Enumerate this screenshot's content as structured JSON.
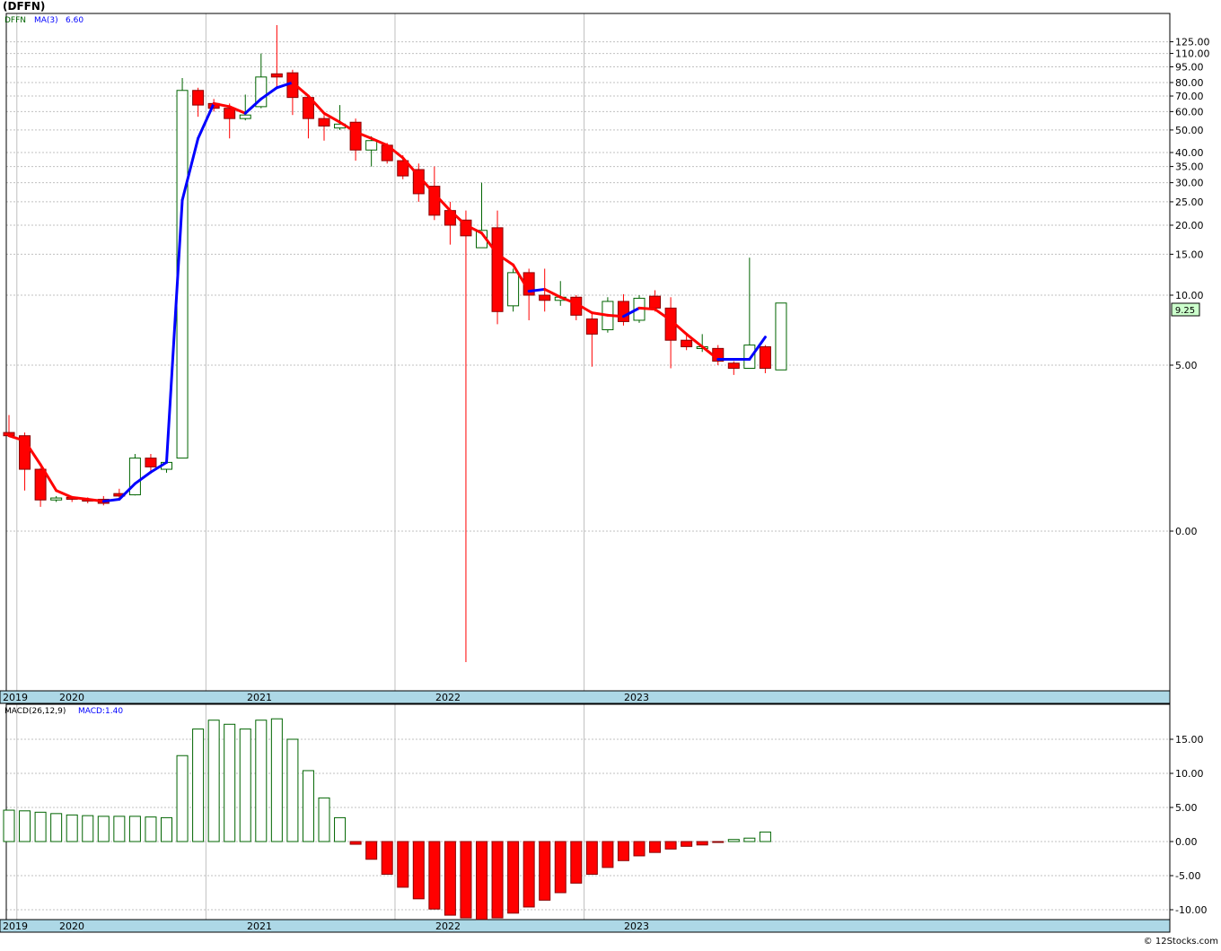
{
  "header": {
    "symbol": "(DFFN)"
  },
  "upper_legend": {
    "symbol": "DFFN",
    "ma_label": "MA(3)",
    "ma_value": "6.60"
  },
  "lower_legend": {
    "label": "MACD(26,12,9)",
    "value_label": "MACD:1.40"
  },
  "last_price_label": "9.25",
  "footer": {
    "copyright": "© 12Stocks.com"
  },
  "colors": {
    "up": "#006400",
    "down": "#ff0000",
    "ma_up": "#0000ff",
    "ma_down": "#ff0000",
    "grid": "#c0c0c0",
    "axis_band": "#add8e6",
    "last_price_bg": "#ccffcc"
  },
  "chart_data": [
    {
      "type": "candlestick",
      "title": "(DFFN)",
      "scale": "log",
      "interval": "monthly",
      "x_axis_labels": [
        "2019",
        "2020",
        "2021",
        "2022",
        "2023"
      ],
      "y_tick_labels": [
        "125.00",
        "110.00",
        "95.00",
        "80.00",
        "70.00",
        "60.00",
        "50.00",
        "40.00",
        "35.00",
        "30.00",
        "25.00",
        "20.00",
        "15.00",
        "10.00",
        "5.00",
        "0.00"
      ],
      "last_close": 9.25,
      "ma_period": 3,
      "ma_last": 6.6,
      "candles": [
        {
          "date": "2019-12",
          "open": 1.9,
          "high": 2.5,
          "low": 1.85,
          "close": 1.8
        },
        {
          "date": "2020-01",
          "open": 1.8,
          "high": 1.9,
          "low": 0.55,
          "close": 0.95
        },
        {
          "date": "2020-02",
          "open": 0.95,
          "high": 0.98,
          "low": 0.3,
          "close": 0.4
        },
        {
          "date": "2020-03",
          "open": 0.4,
          "high": 0.46,
          "low": 0.37,
          "close": 0.43
        },
        {
          "date": "2020-04",
          "open": 0.44,
          "high": 0.45,
          "low": 0.37,
          "close": 0.41
        },
        {
          "date": "2020-05",
          "open": 0.41,
          "high": 0.44,
          "low": 0.35,
          "close": 0.4
        },
        {
          "date": "2020-06",
          "open": 0.41,
          "high": 0.46,
          "low": 0.32,
          "close": 0.35
        },
        {
          "date": "2020-07",
          "open": 0.5,
          "high": 0.58,
          "low": 0.4,
          "close": 0.46
        },
        {
          "date": "2020-08",
          "open": 0.48,
          "high": 1.3,
          "low": 0.47,
          "close": 1.2
        },
        {
          "date": "2020-09",
          "open": 1.2,
          "high": 1.3,
          "low": 0.9,
          "close": 1.0
        },
        {
          "date": "2020-10",
          "open": 0.95,
          "high": 1.45,
          "low": 0.88,
          "close": 1.1
        },
        {
          "date": "2020-11",
          "open": 1.2,
          "high": 84,
          "low": 1.2,
          "close": 74
        },
        {
          "date": "2020-12",
          "open": 74,
          "high": 76,
          "low": 57,
          "close": 64
        },
        {
          "date": "2021-01",
          "open": 65,
          "high": 68,
          "low": 60,
          "close": 62
        },
        {
          "date": "2021-02",
          "open": 62,
          "high": 65,
          "low": 46,
          "close": 56
        },
        {
          "date": "2021-03",
          "open": 56,
          "high": 71,
          "low": 55,
          "close": 58
        },
        {
          "date": "2021-04",
          "open": 63,
          "high": 110,
          "low": 62,
          "close": 85
        },
        {
          "date": "2021-05",
          "open": 88,
          "high": 150,
          "low": 75,
          "close": 85
        },
        {
          "date": "2021-06",
          "open": 89,
          "high": 92,
          "low": 58,
          "close": 69
        },
        {
          "date": "2021-07",
          "open": 69,
          "high": 71,
          "low": 46,
          "close": 56
        },
        {
          "date": "2021-08",
          "open": 56,
          "high": 58,
          "low": 45,
          "close": 52
        },
        {
          "date": "2021-09",
          "open": 51,
          "high": 64,
          "low": 50,
          "close": 53
        },
        {
          "date": "2021-10",
          "open": 54,
          "high": 56,
          "low": 37,
          "close": 41
        },
        {
          "date": "2021-11",
          "open": 41,
          "high": 47,
          "low": 35,
          "close": 45
        },
        {
          "date": "2021-12",
          "open": 43,
          "high": 44,
          "low": 36,
          "close": 37
        },
        {
          "date": "2022-01",
          "open": 37,
          "high": 39,
          "low": 31,
          "close": 32
        },
        {
          "date": "2022-02",
          "open": 34,
          "high": 36,
          "low": 25,
          "close": 27
        },
        {
          "date": "2022-03",
          "open": 29,
          "high": 35,
          "low": 21,
          "close": 22
        },
        {
          "date": "2022-04",
          "open": 23,
          "high": 25,
          "low": 16.5,
          "close": 20
        },
        {
          "date": "2022-05",
          "open": 21,
          "high": 23,
          "low": -2.4,
          "close": 18
        },
        {
          "date": "2022-06",
          "open": 16,
          "high": 30,
          "low": 16,
          "close": 19
        },
        {
          "date": "2022-07",
          "open": 19.5,
          "high": 23,
          "low": 7.5,
          "close": 8.5
        },
        {
          "date": "2022-08",
          "open": 9,
          "high": 13,
          "low": 8.5,
          "close": 12.5
        },
        {
          "date": "2022-09",
          "open": 12.5,
          "high": 13,
          "low": 7.8,
          "close": 10
        },
        {
          "date": "2022-10",
          "open": 10,
          "high": 13,
          "low": 8.5,
          "close": 9.5
        },
        {
          "date": "2022-11",
          "open": 9.5,
          "high": 11.5,
          "low": 9,
          "close": 9.8
        },
        {
          "date": "2022-12",
          "open": 9.8,
          "high": 10,
          "low": 7.8,
          "close": 8.2
        },
        {
          "date": "2023-01",
          "open": 7.9,
          "high": 8.3,
          "low": 4.9,
          "close": 6.8
        },
        {
          "date": "2023-02",
          "open": 7.1,
          "high": 9.8,
          "low": 6.9,
          "close": 9.4
        },
        {
          "date": "2023-03",
          "open": 9.4,
          "high": 10.1,
          "low": 7.4,
          "close": 7.7
        },
        {
          "date": "2023-04",
          "open": 7.8,
          "high": 10,
          "low": 7.6,
          "close": 9.7
        },
        {
          "date": "2023-05",
          "open": 9.9,
          "high": 10.5,
          "low": 8.5,
          "close": 8.8
        },
        {
          "date": "2023-06",
          "open": 8.8,
          "high": 9.8,
          "low": 4.8,
          "close": 6.4
        },
        {
          "date": "2023-07",
          "open": 6.4,
          "high": 6.8,
          "low": 5.8,
          "close": 6.0
        },
        {
          "date": "2023-08",
          "open": 5.9,
          "high": 6.8,
          "low": 5.7,
          "close": 6.0
        },
        {
          "date": "2023-09",
          "open": 5.9,
          "high": 6.1,
          "low": 5.0,
          "close": 5.2
        },
        {
          "date": "2023-10",
          "open": 5.1,
          "high": 5.2,
          "low": 4.4,
          "close": 4.8
        },
        {
          "date": "2023-11",
          "open": 4.8,
          "high": 14.5,
          "low": 4.8,
          "close": 6.1
        },
        {
          "date": "2023-12",
          "open": 6.0,
          "high": 6.1,
          "low": 4.5,
          "close": 4.8
        },
        {
          "date": "2024-01",
          "open": 4.7,
          "high": 9.25,
          "low": 4.7,
          "close": 9.25
        }
      ],
      "ma3": [
        1.8,
        1.65,
        1.05,
        0.55,
        0.44,
        0.41,
        0.38,
        0.41,
        0.67,
        0.89,
        1.1,
        25.4,
        46,
        65,
        63,
        59,
        68,
        76,
        80,
        70,
        59,
        54,
        49,
        46,
        43,
        38,
        32,
        27,
        23,
        20,
        18.5,
        15,
        13.5,
        10.4,
        10.6,
        9.8,
        9.2,
        8.4,
        8.2,
        8.1,
        8.8,
        8.7,
        7.8,
        6.8,
        6.0,
        5.3,
        5.3,
        5.3,
        6.6
      ]
    },
    {
      "type": "bar",
      "title": "MACD(26,12,9)",
      "x_axis_labels": [
        "2019",
        "2020",
        "2021",
        "2022",
        "2023"
      ],
      "y_tick_labels": [
        "15.00",
        "10.00",
        "5.00",
        "0.00",
        "-5.00",
        "-10.00"
      ],
      "ylim": [
        -11.5,
        19
      ],
      "values": [
        4.6,
        4.5,
        4.3,
        4.1,
        3.9,
        3.8,
        3.7,
        3.7,
        3.7,
        3.6,
        3.5,
        12.6,
        16.5,
        17.8,
        17.2,
        16.5,
        17.8,
        18.0,
        15.0,
        10.4,
        6.4,
        3.5,
        -0.4,
        -2.6,
        -4.8,
        -6.7,
        -8.4,
        -9.9,
        -10.8,
        -11.2,
        -11.4,
        -11.2,
        -10.5,
        -9.6,
        -8.6,
        -7.5,
        -6.1,
        -4.8,
        -3.8,
        -2.8,
        -2.1,
        -1.6,
        -1.1,
        -0.7,
        -0.5,
        -0.1,
        0.3,
        0.5,
        1.4
      ]
    }
  ]
}
